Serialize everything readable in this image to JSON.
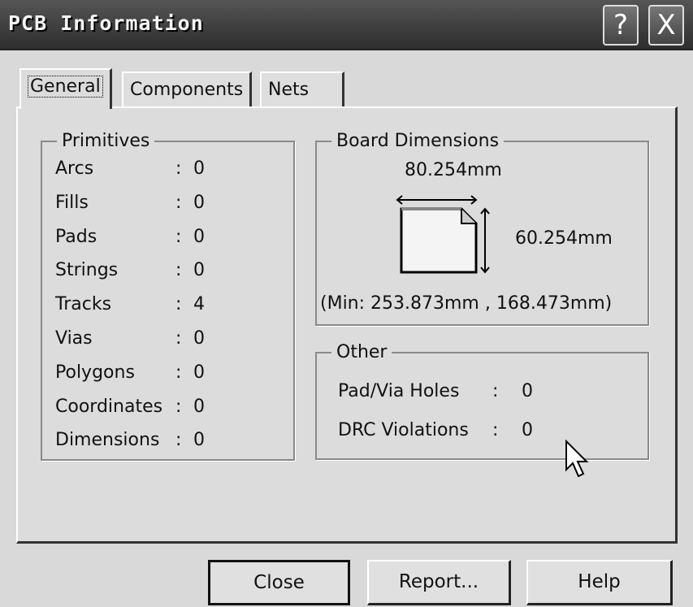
{
  "window": {
    "title": "PCB Information",
    "help_label": "?",
    "close_label": "X"
  },
  "tabs": [
    {
      "label": "General"
    },
    {
      "label": "Components"
    },
    {
      "label": "Nets"
    }
  ],
  "primitives": {
    "title": "Primitives",
    "rows": [
      {
        "label": "Arcs",
        "value": "0"
      },
      {
        "label": "Fills",
        "value": "0"
      },
      {
        "label": "Pads",
        "value": "0"
      },
      {
        "label": "Strings",
        "value": "0"
      },
      {
        "label": "Tracks",
        "value": "4"
      },
      {
        "label": "Vias",
        "value": "0"
      },
      {
        "label": "Polygons",
        "value": "0"
      },
      {
        "label": "Coordinates",
        "value": "0"
      },
      {
        "label": "Dimensions",
        "value": "0"
      }
    ]
  },
  "board": {
    "title": "Board Dimensions",
    "width": "80.254mm",
    "height": "60.254mm",
    "min": "(Min: 253.873mm , 168.473mm)"
  },
  "other": {
    "title": "Other",
    "rows": [
      {
        "label": "Pad/Via Holes",
        "value": "0"
      },
      {
        "label": "DRC Violations",
        "value": "0"
      }
    ]
  },
  "buttons": {
    "close": "Close",
    "report": "Report...",
    "help": "Help"
  },
  "colon": ":"
}
